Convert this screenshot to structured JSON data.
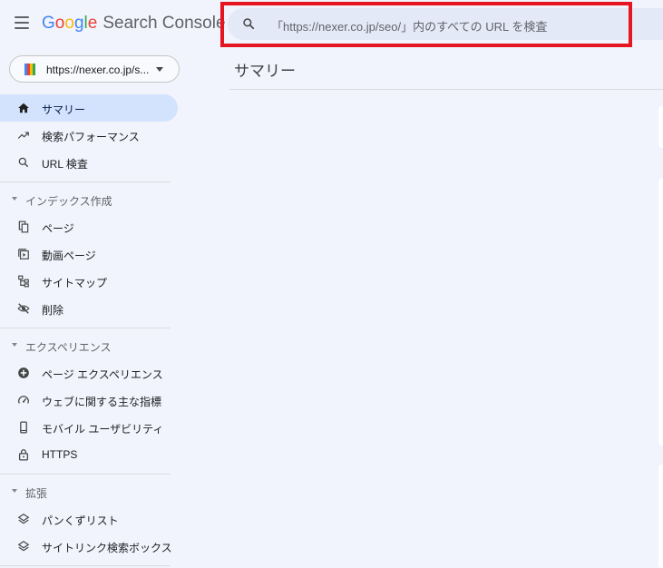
{
  "header": {
    "logo": {
      "letters": [
        "G",
        "o",
        "o",
        "g",
        "l",
        "e"
      ],
      "product": "Search Console"
    },
    "search": {
      "placeholder": "「https://nexer.co.jp/seo/」内のすべての URL を検査"
    }
  },
  "property": {
    "label": "https://nexer.co.jp/s..."
  },
  "sidebar": {
    "main": [
      {
        "label": "サマリー",
        "icon": "home-icon",
        "active": true
      },
      {
        "label": "検索パフォーマンス",
        "icon": "trending-up-icon"
      },
      {
        "label": "URL 検査",
        "icon": "search-icon"
      }
    ],
    "sections": [
      {
        "title": "インデックス作成",
        "items": [
          {
            "label": "ページ",
            "icon": "pages-icon"
          },
          {
            "label": "動画ページ",
            "icon": "video-page-icon"
          },
          {
            "label": "サイトマップ",
            "icon": "sitemap-icon"
          },
          {
            "label": "削除",
            "icon": "visibility-off-icon"
          }
        ]
      },
      {
        "title": "エクスペリエンス",
        "items": [
          {
            "label": "ページ エクスペリエンス",
            "icon": "add-circle-icon"
          },
          {
            "label": "ウェブに関する主な指標",
            "icon": "speed-gauge-icon"
          },
          {
            "label": "モバイル ユーザビリティ",
            "icon": "smartphone-icon"
          },
          {
            "label": "HTTPS",
            "icon": "lock-icon"
          }
        ]
      },
      {
        "title": "拡張",
        "items": [
          {
            "label": "パンくずリスト",
            "icon": "layers-icon"
          },
          {
            "label": "サイトリンク検索ボックス",
            "icon": "layers-icon"
          }
        ]
      }
    ]
  },
  "main": {
    "title": "サマリー"
  },
  "colors": {
    "highlight": "#e5161f",
    "active_bg": "#d3e3fd",
    "background": "#f1f4fc"
  }
}
